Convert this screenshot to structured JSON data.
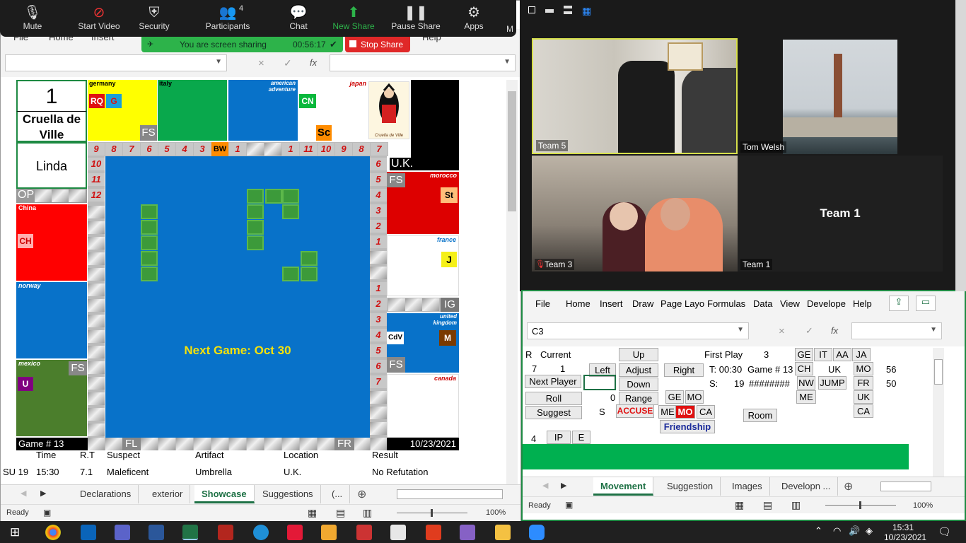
{
  "zoom": {
    "toolbar": {
      "mute": "Mute",
      "start_video": "Start Video",
      "security": "Security",
      "participants": "Participants",
      "participants_count": "4",
      "chat": "Chat",
      "new_share": "New Share",
      "pause_share": "Pause Share",
      "apps": "Apps",
      "more_cut": "M"
    },
    "sharing_banner": "You are screen sharing",
    "sharing_timer": "00:56:17",
    "stop_share": "Stop Share",
    "participants_tiles": [
      {
        "name": "Team 5"
      },
      {
        "name": "Tom Welsh"
      },
      {
        "name": "Team 3"
      },
      {
        "name": "Team 1"
      }
    ],
    "team1_placeholder": "Team 1"
  },
  "left_excel": {
    "ribbon_cut": [
      "File",
      "Home",
      "Insert",
      "Help"
    ],
    "formula_icons": [
      "×",
      "✓",
      "fx"
    ],
    "board": {
      "card_number": "1",
      "card_name": "Cruella de Ville",
      "player": "Linda",
      "countries": {
        "germany": "germany",
        "italy": "italy",
        "american": "american adventure",
        "japan": "japan",
        "morocco": "morocco",
        "france": "france",
        "united_kingdom": "united kingdom",
        "canada": "canada",
        "china": "China",
        "norway": "norway",
        "mexico": "mexico"
      },
      "tags": {
        "rq": "RQ",
        "g": "G",
        "cn": "CN",
        "sc": "Sc",
        "st": "St",
        "j": "J",
        "cdv": "CdV",
        "m": "M",
        "ch": "CH",
        "u": "U",
        "bw": "BW"
      },
      "fs_labels": [
        "FS",
        "FS",
        "FS",
        "FS"
      ],
      "op": "OP",
      "uk": "U.K.",
      "ig": "IG",
      "fl": "FL",
      "fr": "FR",
      "top_numbers": [
        "9",
        "8",
        "7",
        "6",
        "5",
        "4",
        "3",
        "1",
        "1",
        "11",
        "10",
        "9",
        "8",
        "7"
      ],
      "left_numbers": [
        "10",
        "11",
        "12"
      ],
      "right_numbers_top": [
        "6",
        "5",
        "4",
        "3",
        "2",
        "1"
      ],
      "right_numbers_bottom": [
        "1",
        "2",
        "3",
        "4",
        "5",
        "6",
        "7"
      ],
      "center_text": "Next Game: Oct 30",
      "game_label": "Game # 13",
      "date_label": "10/23/2021",
      "cruella_caption": "Cruella de Ville"
    },
    "table": {
      "headers": [
        "Time",
        "R.T",
        "Suspect",
        "Artifact",
        "Location",
        "Result"
      ],
      "row": [
        "SU 19",
        "15:30",
        "7.1",
        "Maleficent",
        "Umbrella",
        "U.K.",
        "No Refutation"
      ]
    },
    "tabs": [
      "Declarations",
      "exterior",
      "Showcase",
      "Suggestions",
      "(..."
    ],
    "active_tab": "Showcase",
    "status": "Ready",
    "zoom": "100%"
  },
  "right_excel": {
    "ribbon": [
      "File",
      "Home",
      "Insert",
      "Draw",
      "Page Layo",
      "Formulas",
      "Data",
      "View",
      "Develope",
      "Help"
    ],
    "name_box": "C3",
    "cells": {
      "r": "R",
      "current": "Current",
      "seven": "7",
      "one": "1",
      "first_play": "First Play",
      "three": "3",
      "t_time": "T: 00:30",
      "game13": "Game # 13",
      "s_label": "S:",
      "nineteen": "19",
      "hashes": "########",
      "zero": "0",
      "s_cell": "S",
      "uk": "UK",
      "n56": "56",
      "n50": "50",
      "four": "4"
    },
    "buttons": {
      "up": "Up",
      "left": "Left",
      "adjust": "Adjust",
      "right": "Right",
      "down": "Down",
      "next_player": "Next Player",
      "roll": "Roll",
      "range": "Range",
      "suggest": "Suggest",
      "accuse": "ACCUSE",
      "friendship": "Friendship",
      "room": "Room",
      "ge": "GE",
      "it": "IT",
      "aa": "AA",
      "ja": "JA",
      "ch": "CH",
      "mo": "MO",
      "nw": "NW",
      "jump": "JUMP",
      "fr": "FR",
      "me": "ME",
      "uk": "UK",
      "ca": "CA",
      "ge2": "GE",
      "mo2": "MO",
      "me2": "ME",
      "mo3": "MO",
      "ca2": "CA",
      "ip": "IP",
      "e": "E"
    },
    "tabs": [
      "Movement",
      "Suggestion",
      "Images",
      "Developn ..."
    ],
    "active_tab": "Movement",
    "status": "Ready",
    "zoom": "100%"
  },
  "taskbar": {
    "time": "15:31",
    "date": "10/23/2021"
  }
}
